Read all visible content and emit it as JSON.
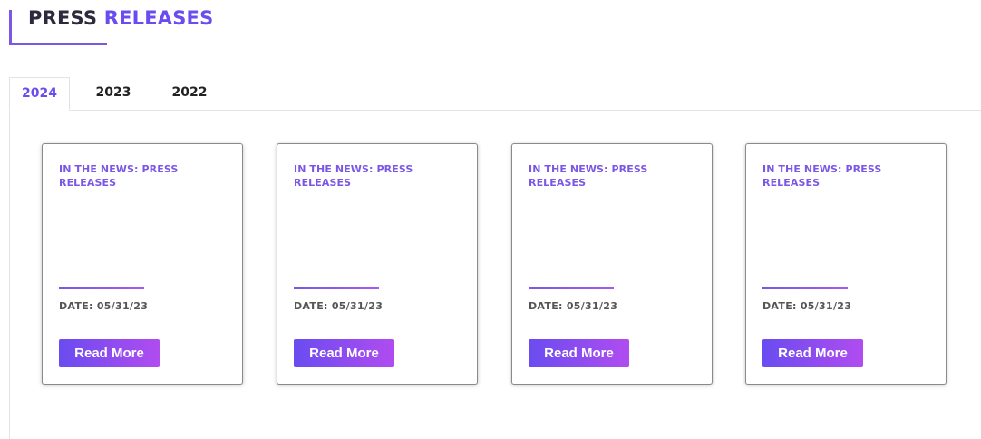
{
  "heading": {
    "word1": "PRESS",
    "word2": "RELEASES"
  },
  "tabs": [
    {
      "label": "2024",
      "active": true
    },
    {
      "label": "2023",
      "active": false
    },
    {
      "label": "2022",
      "active": false
    }
  ],
  "cards": [
    {
      "title": "IN THE NEWS: PRESS RELEASES",
      "date": "DATE: 05/31/23",
      "button": "Read More"
    },
    {
      "title": "IN THE NEWS: PRESS RELEASES",
      "date": "DATE: 05/31/23",
      "button": "Read More"
    },
    {
      "title": "IN THE NEWS: PRESS RELEASES",
      "date": "DATE: 05/31/23",
      "button": "Read More"
    },
    {
      "title": "IN THE NEWS: PRESS RELEASES",
      "date": "DATE: 05/31/23",
      "button": "Read More"
    }
  ],
  "colors": {
    "accent": "#6a4cf0",
    "accent_light": "#7b57e6",
    "heading_dark": "#2c2b3d",
    "date_text": "#555555",
    "button_gradient_end": "#b04cf0"
  }
}
